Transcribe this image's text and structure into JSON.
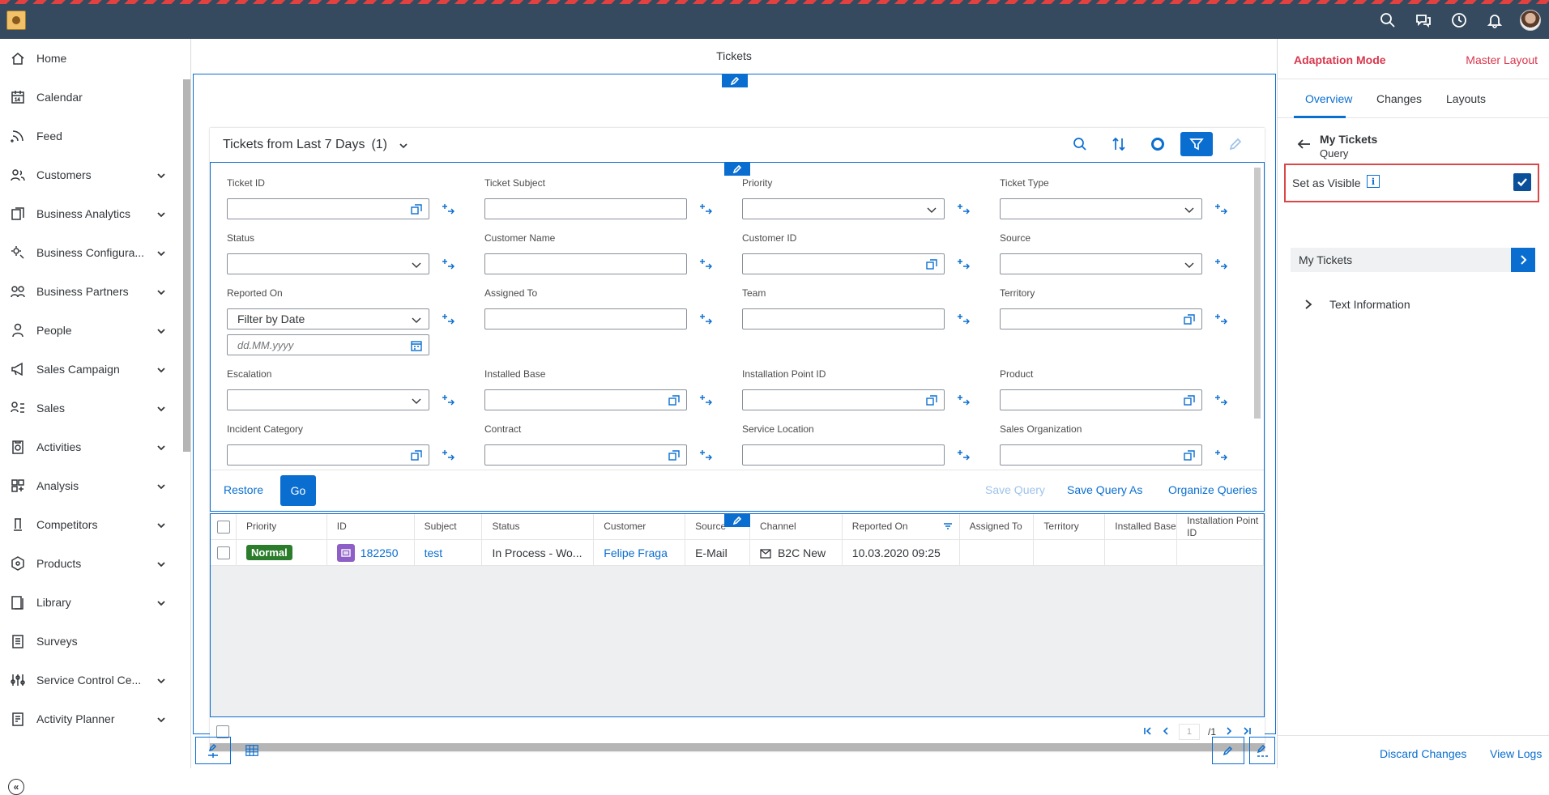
{
  "sidebar": {
    "items": [
      {
        "label": "Home",
        "icon": "home-icon",
        "expandable": false
      },
      {
        "label": "Calendar",
        "icon": "calendar-icon",
        "expandable": false
      },
      {
        "label": "Feed",
        "icon": "feed-icon",
        "expandable": false
      },
      {
        "label": "Customers",
        "icon": "customers-icon",
        "expandable": true
      },
      {
        "label": "Business Analytics",
        "icon": "business-analytics-icon",
        "expandable": true
      },
      {
        "label": "Business Configura...",
        "icon": "business-configuration-icon",
        "expandable": true
      },
      {
        "label": "Business Partners",
        "icon": "business-partners-icon",
        "expandable": true
      },
      {
        "label": "People",
        "icon": "people-icon",
        "expandable": true
      },
      {
        "label": "Sales Campaign",
        "icon": "megaphone-icon",
        "expandable": true
      },
      {
        "label": "Sales",
        "icon": "sales-icon",
        "expandable": true
      },
      {
        "label": "Activities",
        "icon": "activities-icon",
        "expandable": true
      },
      {
        "label": "Analysis",
        "icon": "analysis-icon",
        "expandable": true
      },
      {
        "label": "Competitors",
        "icon": "competitors-icon",
        "expandable": true
      },
      {
        "label": "Products",
        "icon": "products-icon",
        "expandable": true
      },
      {
        "label": "Library",
        "icon": "library-icon",
        "expandable": true
      },
      {
        "label": "Surveys",
        "icon": "surveys-icon",
        "expandable": false
      },
      {
        "label": "Service Control Ce...",
        "icon": "service-control-icon",
        "expandable": true
      },
      {
        "label": "Activity Planner",
        "icon": "activity-planner-icon",
        "expandable": true
      }
    ]
  },
  "page": {
    "title": "Tickets",
    "card_title": "Tickets from Last 7 Days",
    "card_count": "(1)"
  },
  "filters": {
    "items": [
      {
        "label": "Ticket ID",
        "type": "value-help",
        "value": ""
      },
      {
        "label": "Ticket Subject",
        "type": "text",
        "value": ""
      },
      {
        "label": "Priority",
        "type": "dropdown",
        "value": ""
      },
      {
        "label": "Ticket Type",
        "type": "dropdown",
        "value": ""
      },
      {
        "label": "Status",
        "type": "dropdown",
        "value": ""
      },
      {
        "label": "Customer Name",
        "type": "text",
        "value": ""
      },
      {
        "label": "Customer ID",
        "type": "value-help",
        "value": ""
      },
      {
        "label": "Source",
        "type": "dropdown",
        "value": ""
      },
      {
        "label": "Reported On",
        "type": "dropdown",
        "value": "Filter by Date"
      },
      {
        "label": "Assigned To",
        "type": "text",
        "value": ""
      },
      {
        "label": "Team",
        "type": "text",
        "value": ""
      },
      {
        "label": "Territory",
        "type": "value-help",
        "value": ""
      },
      {
        "label": "Escalation",
        "type": "dropdown",
        "value": ""
      },
      {
        "label": "Installed Base",
        "type": "value-help",
        "value": ""
      },
      {
        "label": "Installation Point ID",
        "type": "value-help",
        "value": ""
      },
      {
        "label": "Product",
        "type": "value-help",
        "value": ""
      },
      {
        "label": "Incident Category",
        "type": "value-help",
        "value": ""
      },
      {
        "label": "Contract",
        "type": "value-help",
        "value": ""
      },
      {
        "label": "Service Location",
        "type": "text",
        "value": ""
      },
      {
        "label": "Sales Organization",
        "type": "value-help",
        "value": ""
      }
    ],
    "date_placeholder": "dd.MM.yyyy",
    "restore_label": "Restore",
    "go_label": "Go",
    "save_query_label": "Save Query",
    "save_query_as_label": "Save Query As",
    "organize_queries_label": "Organize Queries"
  },
  "table": {
    "columns": [
      "Priority",
      "ID",
      "Subject",
      "Status",
      "Customer",
      "Source",
      "Channel",
      "Reported On",
      "Assigned To",
      "Territory",
      "Installed Base",
      "Installation Point ID"
    ],
    "rows": [
      {
        "priority": "Normal",
        "id": "182250",
        "subject": "test",
        "status": "In Process - Wo...",
        "customer": "Felipe Fraga",
        "source": "E-Mail",
        "channel": "B2C New",
        "reported_on": "10.03.2020 09:25",
        "assigned_to": "",
        "territory": "",
        "installed_base": "",
        "installation_point_id": ""
      }
    ]
  },
  "pager": {
    "current": "1",
    "total": "/1"
  },
  "right_panel": {
    "mode_title": "Adaptation Mode",
    "layout_link": "Master Layout",
    "tabs": [
      "Overview",
      "Changes",
      "Layouts"
    ],
    "query_title": "My Tickets",
    "query_subtitle": "Query",
    "visible_label": "Set as Visible",
    "visible_checked": true,
    "mytickets_bar_label": "My Tickets",
    "text_info_label": "Text Information",
    "discard_label": "Discard Changes",
    "view_logs_label": "View Logs"
  },
  "colors": {
    "shell": "#354a5f",
    "accent": "#0a6ed1",
    "adaptation_red": "#d9364c",
    "priority_normal": "#2b7d2b"
  }
}
